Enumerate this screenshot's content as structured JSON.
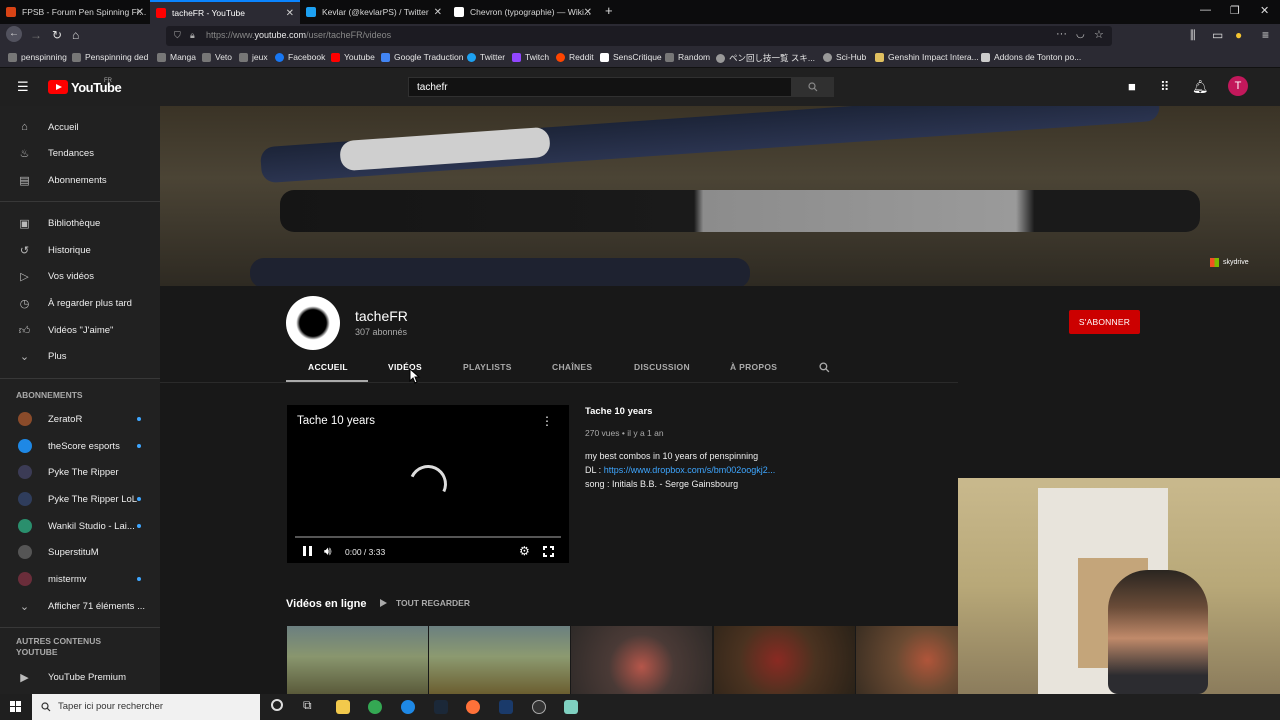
{
  "browser": {
    "tabs": [
      {
        "label": "FPSB - Forum Pen Spinning Fr...",
        "active": false
      },
      {
        "label": "tacheFR - YouTube",
        "active": true
      },
      {
        "label": "Kevlar (@kevlarPS) / Twitter",
        "active": false
      },
      {
        "label": "Chevron (typographie) — Wiki...",
        "active": false
      }
    ],
    "url_prefix": "https://www.",
    "url_domain": "youtube.com",
    "url_path": "/user/tacheFR/videos",
    "bookmarks": [
      "penspinning",
      "Penspinning ded",
      "Manga",
      "Veto",
      "jeux",
      "Facebook",
      "Youtube",
      "Google Traduction",
      "Twitter",
      "Twitch",
      "Reddit",
      "SensCritique",
      "Random",
      "ペン回し技一覧 スキ...",
      "Sci-Hub",
      "Genshin Impact Intera...",
      "Addons de Tonton po..."
    ]
  },
  "header": {
    "logo": "YouTube",
    "region": "FR",
    "search_value": "tachefr",
    "avatar_letter": "T"
  },
  "sidebar": {
    "main": [
      {
        "icon": "home-icon",
        "label": "Accueil"
      },
      {
        "icon": "trending-icon",
        "label": "Tendances"
      },
      {
        "icon": "subscriptions-icon",
        "label": "Abonnements"
      }
    ],
    "library": [
      {
        "icon": "library-icon",
        "label": "Bibliothèque"
      },
      {
        "icon": "history-icon",
        "label": "Historique"
      },
      {
        "icon": "your-videos-icon",
        "label": "Vos vidéos"
      },
      {
        "icon": "watch-later-icon",
        "label": "À regarder plus tard"
      },
      {
        "icon": "like-icon",
        "label": "Vidéos \"J'aime\""
      },
      {
        "icon": "chevron-down-icon",
        "label": "Plus"
      }
    ],
    "subs_heading": "ABONNEMENTS",
    "subscriptions": [
      {
        "label": "ZeratoR",
        "color": "#8a4b2a",
        "new": true
      },
      {
        "label": "theScore esports",
        "color": "#1e88e5",
        "new": true
      },
      {
        "label": "Pyke The Ripper",
        "color": "#3b3b55",
        "new": false
      },
      {
        "label": "Pyke The Ripper LoL",
        "color": "#2f3d5c",
        "new": true
      },
      {
        "label": "Wankil Studio - Lai...",
        "color": "#2a8f6d",
        "new": true
      },
      {
        "label": "SuperstituM",
        "color": "#555555",
        "new": false
      },
      {
        "label": "mistermv",
        "color": "#6a2d3a",
        "new": true
      }
    ],
    "show_more": "Afficher 71 éléments ...",
    "other_heading": "AUTRES CONTENUS YOUTUBE",
    "premium": "YouTube Premium"
  },
  "channel": {
    "name": "tacheFR",
    "subs": "307 abonnés",
    "subscribe_label": "S'ABONNER",
    "tabs": [
      "ACCUEIL",
      "VIDÉOS",
      "PLAYLISTS",
      "CHAÎNES",
      "DISCUSSION",
      "À PROPOS"
    ],
    "active_tab": "ACCUEIL",
    "banner_watermark": "skydrive"
  },
  "featured": {
    "player_title": "Tache 10 years",
    "time": "0:00 / 3:33",
    "title": "Tache 10 years",
    "meta": "270 vues • il y a 1 an",
    "desc_line1": "my best combos in 10 years of penspinning",
    "desc_dl_prefix": "DL : ",
    "desc_link": "https://www.dropbox.com/s/bm002oogkj2...",
    "desc_line3": "song : Initials B.B. - Serge Gainsbourg"
  },
  "shelf": {
    "title": "Vidéos en ligne",
    "play_all": "TOUT REGARDER"
  },
  "taskbar": {
    "search_placeholder": "Taper ici pour rechercher"
  }
}
